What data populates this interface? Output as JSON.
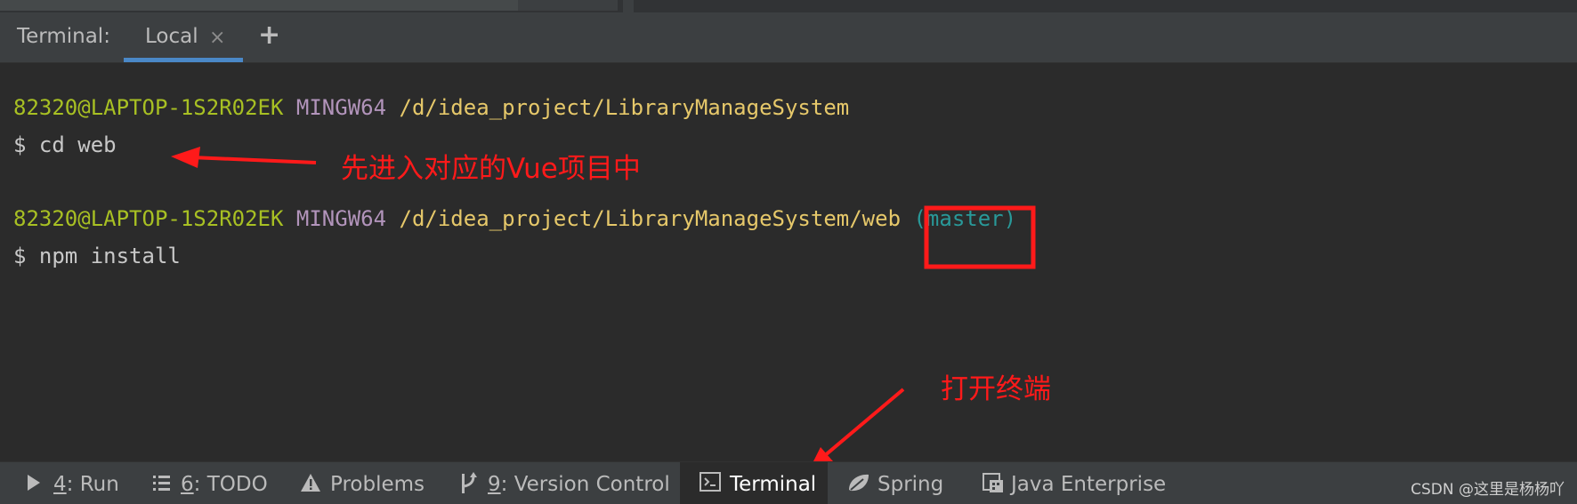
{
  "top_strip": {
    "cut_text": "- ~~~ ~~~~~~~~~~~~~ ~"
  },
  "terminal_header": {
    "title": "Terminal:",
    "tab_label": "Local",
    "close_glyph": "×",
    "add_glyph": "+"
  },
  "terminal": {
    "blocks": [
      {
        "user": "82320@LAPTOP-1S2R02EK",
        "system": "MINGW64",
        "path": "/d/idea_project/LibraryManageSystem",
        "command": "$ cd web"
      },
      {
        "user": "82320@LAPTOP-1S2R02EK",
        "system": "MINGW64",
        "path": "/d/idea_project/LibraryManageSystem/web",
        "branch": "(master)",
        "command": "$ npm install"
      }
    ]
  },
  "annotations": {
    "enter_project": "先进入对应的Vue项目中",
    "open_terminal": "打开终端",
    "color": "#ff1a1a"
  },
  "bottom_bar": {
    "run": {
      "num": "4",
      "label": ": Run",
      "icon": "play-icon"
    },
    "todo": {
      "num": "6",
      "label": ": TODO",
      "icon": "list-icon"
    },
    "problems": {
      "label": "Problems",
      "icon": "warning-icon"
    },
    "vcs": {
      "num": "9",
      "label": ": Version Control",
      "icon": "branch-icon"
    },
    "terminal": {
      "label": "Terminal",
      "icon": "terminal-icon"
    },
    "spring": {
      "label": "Spring",
      "icon": "spring-leaf-icon"
    },
    "java_enterprise": {
      "label": "Java Enterprise",
      "icon": "java-enterprise-icon"
    }
  },
  "watermark": "CSDN @这里是杨杨吖",
  "colors": {
    "background": "#2b2b2b",
    "panel": "#3c3f41",
    "user": "#a8c023",
    "system": "#b294bb",
    "path": "#e6c86a",
    "branch": "#299999",
    "tab_underline": "#4a88c7"
  }
}
